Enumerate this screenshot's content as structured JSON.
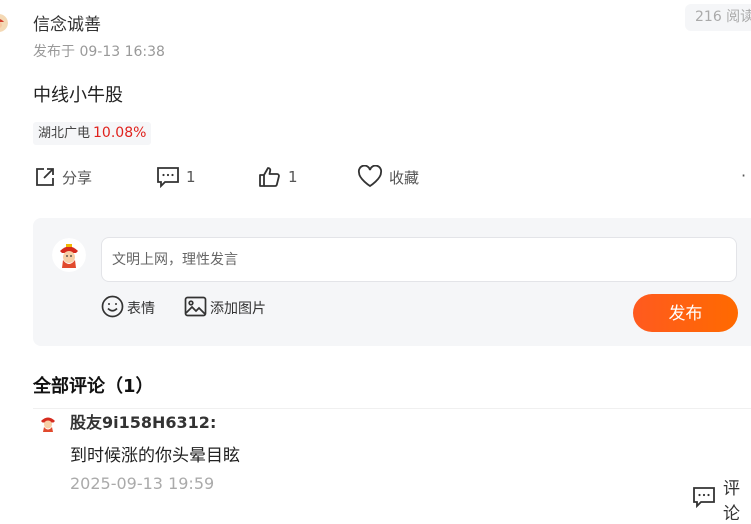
{
  "post": {
    "author": "信念诚善",
    "time": "发布于 09-13 16:38",
    "read_count": "216 阅读",
    "title": "中线小牛股",
    "stock": {
      "name": "湖北广电",
      "change": "10.08%",
      "change_color": "#e0221d"
    }
  },
  "actions": {
    "share_label": "分享",
    "comment_count": "1",
    "like_count": "1",
    "favorite_label": "收藏",
    "more": "·"
  },
  "reply_box": {
    "placeholder": "文明上网，理性发言",
    "emoji_label": "表情",
    "image_label": "添加图片",
    "publish_label": "发布",
    "accent": "#ff6a00"
  },
  "comments": {
    "heading": "全部评论（1）",
    "items": [
      {
        "user": "股友9i158H6312:",
        "text": "到时候涨的你头晕目眩",
        "time": "2025-09-13 19:59",
        "reply_label": "评论"
      }
    ]
  }
}
